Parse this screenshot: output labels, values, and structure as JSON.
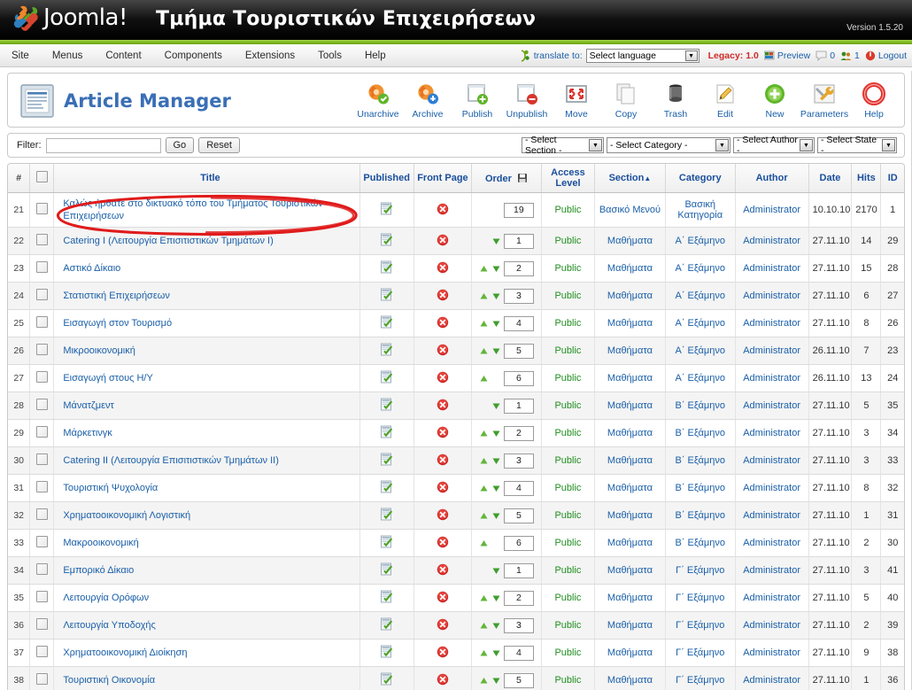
{
  "header": {
    "brand": "Joomla!",
    "site_title": "Τμήμα Τουριστικών Επιχειρήσεων",
    "version": "Version 1.5.20"
  },
  "menubar": {
    "items": [
      {
        "label": "Site"
      },
      {
        "label": "Menus"
      },
      {
        "label": "Content"
      },
      {
        "label": "Components"
      },
      {
        "label": "Extensions"
      },
      {
        "label": "Tools"
      },
      {
        "label": "Help"
      }
    ],
    "translate_label": "translate to:",
    "language_value": "Select language",
    "legacy": "Legacy: 1.0",
    "preview": "Preview",
    "messages_count": "0",
    "users_count": "1",
    "logout": "Logout"
  },
  "page": {
    "title": "Article Manager"
  },
  "toolbar": {
    "buttons": [
      {
        "label": "Unarchive",
        "icon": "unarchive-icon"
      },
      {
        "label": "Archive",
        "icon": "archive-icon"
      },
      {
        "label": "Publish",
        "icon": "publish-icon"
      },
      {
        "label": "Unpublish",
        "icon": "unpublish-icon"
      },
      {
        "label": "Move",
        "icon": "move-icon"
      },
      {
        "label": "Copy",
        "icon": "copy-icon"
      },
      {
        "label": "Trash",
        "icon": "trash-icon"
      },
      {
        "label": "Edit",
        "icon": "edit-icon"
      },
      {
        "label": "New",
        "icon": "new-icon"
      },
      {
        "label": "Parameters",
        "icon": "parameters-icon"
      },
      {
        "label": "Help",
        "icon": "help-icon"
      }
    ]
  },
  "filter": {
    "label": "Filter:",
    "value": "",
    "placeholder": "",
    "go_label": "Go",
    "reset_label": "Reset",
    "select_section": "- Select Section -",
    "select_category": "- Select Category -",
    "select_author": "- Select Author -",
    "select_state": "- Select State -"
  },
  "table": {
    "headers": {
      "num": "#",
      "title": "Title",
      "published": "Published",
      "front_page": "Front Page",
      "order": "Order",
      "access_level": "Access Level",
      "section": "Section",
      "category": "Category",
      "author": "Author",
      "date": "Date",
      "hits": "Hits",
      "id": "ID"
    },
    "rows": [
      {
        "num": "21",
        "title": "Καλώς ήρθατε στο δικτυακό τόπο του Τμήματος Τουριστικών Επιχειρήσεων",
        "published": true,
        "front_page": false,
        "order": "19",
        "up": false,
        "down": false,
        "access": "Public",
        "section": "Βασικό Μενού",
        "category": "Βασική Κατηγορία",
        "author": "Administrator",
        "date": "10.10.10",
        "hits": "2170",
        "id": "1"
      },
      {
        "num": "22",
        "title": "Catering I (Λειτουργία Επισιτιστικών Τμημάτων I)",
        "published": true,
        "front_page": false,
        "order": "1",
        "up": false,
        "down": true,
        "access": "Public",
        "section": "Μαθήματα",
        "category": "Α΄ Εξάμηνο",
        "author": "Administrator",
        "date": "27.11.10",
        "hits": "14",
        "id": "29"
      },
      {
        "num": "23",
        "title": "Αστικό Δίκαιο",
        "published": true,
        "front_page": false,
        "order": "2",
        "up": true,
        "down": true,
        "access": "Public",
        "section": "Μαθήματα",
        "category": "Α΄ Εξάμηνο",
        "author": "Administrator",
        "date": "27.11.10",
        "hits": "15",
        "id": "28"
      },
      {
        "num": "24",
        "title": "Στατιστική Επιχειρήσεων",
        "published": true,
        "front_page": false,
        "order": "3",
        "up": true,
        "down": true,
        "access": "Public",
        "section": "Μαθήματα",
        "category": "Α΄ Εξάμηνο",
        "author": "Administrator",
        "date": "27.11.10",
        "hits": "6",
        "id": "27"
      },
      {
        "num": "25",
        "title": "Εισαγωγή στον Τουρισμό",
        "published": true,
        "front_page": false,
        "order": "4",
        "up": true,
        "down": true,
        "access": "Public",
        "section": "Μαθήματα",
        "category": "Α΄ Εξάμηνο",
        "author": "Administrator",
        "date": "27.11.10",
        "hits": "8",
        "id": "26"
      },
      {
        "num": "26",
        "title": "Μικροοικονομική",
        "published": true,
        "front_page": false,
        "order": "5",
        "up": true,
        "down": true,
        "access": "Public",
        "section": "Μαθήματα",
        "category": "Α΄ Εξάμηνο",
        "author": "Administrator",
        "date": "26.11.10",
        "hits": "7",
        "id": "23"
      },
      {
        "num": "27",
        "title": "Εισαγωγή στους Η/Υ",
        "published": true,
        "front_page": false,
        "order": "6",
        "up": true,
        "down": false,
        "access": "Public",
        "section": "Μαθήματα",
        "category": "Α΄ Εξάμηνο",
        "author": "Administrator",
        "date": "26.11.10",
        "hits": "13",
        "id": "24"
      },
      {
        "num": "28",
        "title": "Μάνατζμεντ",
        "published": true,
        "front_page": false,
        "order": "1",
        "up": false,
        "down": true,
        "access": "Public",
        "section": "Μαθήματα",
        "category": "Β΄ Εξάμηνο",
        "author": "Administrator",
        "date": "27.11.10",
        "hits": "5",
        "id": "35"
      },
      {
        "num": "29",
        "title": "Μάρκετινγκ",
        "published": true,
        "front_page": false,
        "order": "2",
        "up": true,
        "down": true,
        "access": "Public",
        "section": "Μαθήματα",
        "category": "Β΄ Εξάμηνο",
        "author": "Administrator",
        "date": "27.11.10",
        "hits": "3",
        "id": "34"
      },
      {
        "num": "30",
        "title": "Catering II (Λειτουργία Επισιτιστικών Τμημάτων II)",
        "published": true,
        "front_page": false,
        "order": "3",
        "up": true,
        "down": true,
        "access": "Public",
        "section": "Μαθήματα",
        "category": "Β΄ Εξάμηνο",
        "author": "Administrator",
        "date": "27.11.10",
        "hits": "3",
        "id": "33"
      },
      {
        "num": "31",
        "title": "Τουριστική Ψυχολογία",
        "published": true,
        "front_page": false,
        "order": "4",
        "up": true,
        "down": true,
        "access": "Public",
        "section": "Μαθήματα",
        "category": "Β΄ Εξάμηνο",
        "author": "Administrator",
        "date": "27.11.10",
        "hits": "8",
        "id": "32"
      },
      {
        "num": "32",
        "title": "Χρηματοοικονομική Λογιστική",
        "published": true,
        "front_page": false,
        "order": "5",
        "up": true,
        "down": true,
        "access": "Public",
        "section": "Μαθήματα",
        "category": "Β΄ Εξάμηνο",
        "author": "Administrator",
        "date": "27.11.10",
        "hits": "1",
        "id": "31"
      },
      {
        "num": "33",
        "title": "Μακροοικονομική",
        "published": true,
        "front_page": false,
        "order": "6",
        "up": true,
        "down": false,
        "access": "Public",
        "section": "Μαθήματα",
        "category": "Β΄ Εξάμηνο",
        "author": "Administrator",
        "date": "27.11.10",
        "hits": "2",
        "id": "30"
      },
      {
        "num": "34",
        "title": "Εμπορικό Δίκαιο",
        "published": true,
        "front_page": false,
        "order": "1",
        "up": false,
        "down": true,
        "access": "Public",
        "section": "Μαθήματα",
        "category": "Γ΄ Εξάμηνο",
        "author": "Administrator",
        "date": "27.11.10",
        "hits": "3",
        "id": "41"
      },
      {
        "num": "35",
        "title": "Λειτουργία Ορόφων",
        "published": true,
        "front_page": false,
        "order": "2",
        "up": true,
        "down": true,
        "access": "Public",
        "section": "Μαθήματα",
        "category": "Γ΄ Εξάμηνο",
        "author": "Administrator",
        "date": "27.11.10",
        "hits": "5",
        "id": "40"
      },
      {
        "num": "36",
        "title": "Λειτουργία Υποδοχής",
        "published": true,
        "front_page": false,
        "order": "3",
        "up": true,
        "down": true,
        "access": "Public",
        "section": "Μαθήματα",
        "category": "Γ΄ Εξάμηνο",
        "author": "Administrator",
        "date": "27.11.10",
        "hits": "2",
        "id": "39"
      },
      {
        "num": "37",
        "title": "Χρηματοοικονομική Διοίκηση",
        "published": true,
        "front_page": false,
        "order": "4",
        "up": true,
        "down": true,
        "access": "Public",
        "section": "Μαθήματα",
        "category": "Γ΄ Εξάμηνο",
        "author": "Administrator",
        "date": "27.11.10",
        "hits": "9",
        "id": "38"
      },
      {
        "num": "38",
        "title": "Τουριστική Οικονομία",
        "published": true,
        "front_page": false,
        "order": "5",
        "up": true,
        "down": true,
        "access": "Public",
        "section": "Μαθήματα",
        "category": "Γ΄ Εξάμηνο",
        "author": "Administrator",
        "date": "27.11.10",
        "hits": "1",
        "id": "36"
      }
    ]
  },
  "annotation": {
    "shape": "ellipse",
    "color": "#e01b1b",
    "target": "row-21-title"
  },
  "colors": {
    "brand_green": "#7cb51f",
    "link_blue": "#1a5fa8",
    "header_blue": "#1a4f9c",
    "public_green": "#1f8f1f",
    "legacy_red": "#d02b2b",
    "annotation_red": "#e01b1b"
  }
}
